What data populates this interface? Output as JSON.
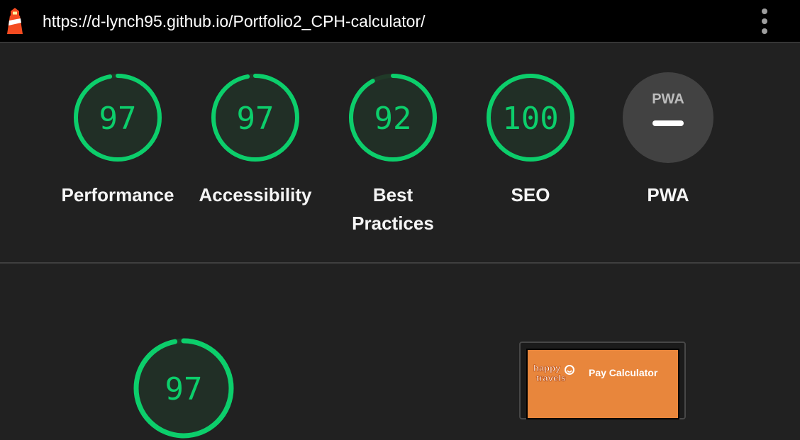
{
  "url_bar": {
    "url": "https://d-lynch95.github.io/Portfolio2_CPH-calculator/"
  },
  "icons": {
    "app": "lighthouse-icon",
    "menu": "kebab-menu-icon",
    "pwa": "pwa-badge-icon",
    "brand": "happy-travels-logo"
  },
  "gauges": [
    {
      "label": "Performance",
      "score": "97",
      "score_value": 97
    },
    {
      "label": "Accessibility",
      "score": "97",
      "score_value": 97
    },
    {
      "label": "Best Practices",
      "score": "92",
      "score_value": 92
    },
    {
      "label": "SEO",
      "score": "100",
      "score_value": 100
    },
    {
      "label": "PWA",
      "score": "",
      "score_value": null
    }
  ],
  "pwa_badge": {
    "text": "PWA"
  },
  "performance_detail": {
    "score": "97",
    "score_value": 97
  },
  "screenshot_preview": {
    "logo_text": "happy travels",
    "title": "Pay Calculator"
  },
  "colors": {
    "pass": "#0cce6b",
    "pass_fill": "#212f26",
    "background": "#212121",
    "topbar": "#000000",
    "pwa_circle": "#424242",
    "thumb_orange": "#e8863c"
  }
}
